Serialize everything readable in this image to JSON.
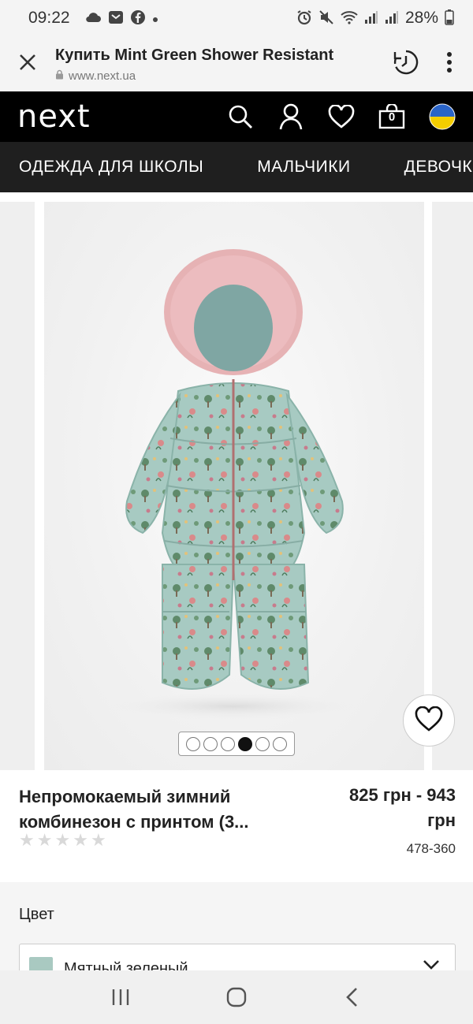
{
  "status_bar": {
    "time": "09:22",
    "battery": "28%",
    "left_icons": [
      "cloud-icon",
      "mail-icon",
      "facebook-icon",
      "dot-icon"
    ],
    "right_icons": [
      "alarm-icon",
      "mute-icon",
      "wifi-icon",
      "signal-icon",
      "signal-icon",
      "battery-icon"
    ]
  },
  "browser": {
    "page_title": "Купить Mint Green Shower Resistant",
    "url": "www.next.ua",
    "close_icon": "close-icon",
    "history_icon": "history-icon",
    "menu_icon": "more-vert-icon"
  },
  "site_header": {
    "logo": "next",
    "icons": [
      "search-icon",
      "account-icon",
      "heart-icon",
      "bag-icon",
      "ukraine-flag-icon"
    ],
    "bag_count": "0",
    "colors": {
      "flag_blue": "#2a64c8",
      "flag_yellow": "#f4cd00"
    }
  },
  "category_nav": {
    "items": [
      "ОДЕЖДА ДЛЯ ШКОЛЫ",
      "МАЛЬЧИКИ",
      "ДЕВОЧКИ"
    ]
  },
  "gallery": {
    "image_alt": "snowsuit-image",
    "dot_count": 6,
    "active_dot": 3,
    "wishlist_icon": "heart-icon"
  },
  "product": {
    "name_line1": "Непромокаемый зимний",
    "name_line2": "комбинезон с принтом (3...",
    "rating": 0,
    "rating_max": 5,
    "price_line1": "825 грн - 943",
    "price_line2": "грн",
    "code": "478-360"
  },
  "color_section": {
    "label": "Цвет",
    "selected": "Мятный зеленый",
    "swatch_color": "#a9c9c1"
  },
  "android_nav": {
    "buttons": [
      "recents-icon",
      "home-icon",
      "back-icon"
    ]
  }
}
